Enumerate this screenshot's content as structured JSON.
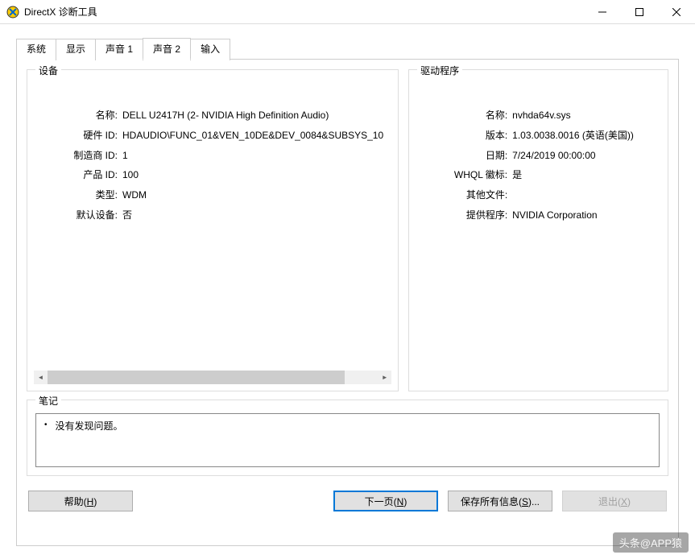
{
  "window": {
    "title": "DirectX 诊断工具"
  },
  "tabs": {
    "system": "系统",
    "display": "显示",
    "sound1": "声音 1",
    "sound2": "声音 2",
    "input": "输入"
  },
  "groups": {
    "device": "设备",
    "driver": "驱动程序",
    "notes": "笔记"
  },
  "device": {
    "labels": {
      "name": "名称:",
      "hwid": "硬件 ID:",
      "mfgid": "制造商 ID:",
      "prodid": "产品 ID:",
      "type": "类型:",
      "defdev": "默认设备:"
    },
    "values": {
      "name": "DELL U2417H (2- NVIDIA High Definition Audio)",
      "hwid": "HDAUDIO\\FUNC_01&VEN_10DE&DEV_0084&SUBSYS_10",
      "mfgid": "1",
      "prodid": "100",
      "type": "WDM",
      "defdev": "否"
    }
  },
  "driver": {
    "labels": {
      "name": "名称:",
      "version": "版本:",
      "date": "日期:",
      "whql": "WHQL 徽标:",
      "other": "其他文件:",
      "provider": "提供程序:"
    },
    "values": {
      "name": "nvhda64v.sys",
      "version": "1.03.0038.0016 (英语(美国))",
      "date": "7/24/2019 00:00:00",
      "whql": "是",
      "other": "",
      "provider": "NVIDIA Corporation"
    }
  },
  "notes": {
    "item1": "没有发现问题。"
  },
  "buttons": {
    "help": "帮助(H)",
    "next": "下一页(N)",
    "saveall": "保存所有信息(S)...",
    "exit": "退出(X)"
  },
  "watermark": "头条@APP猿"
}
